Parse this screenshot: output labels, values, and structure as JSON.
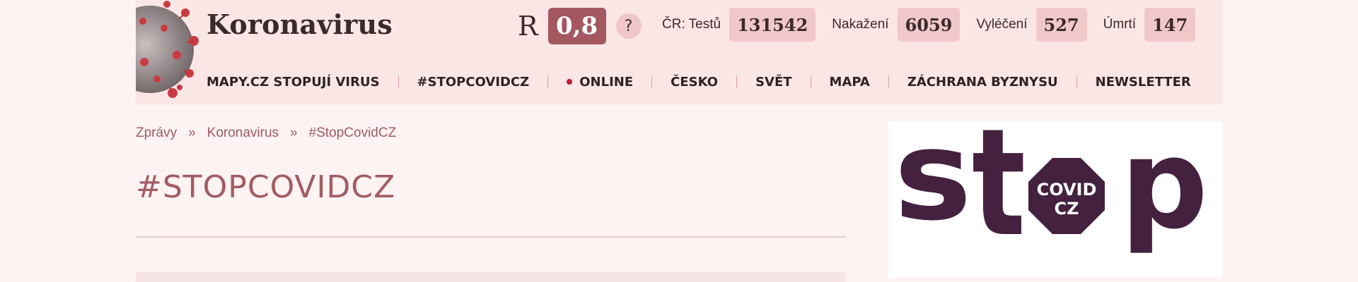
{
  "header": {
    "logo_text": "Koronavirus",
    "r_label": "R",
    "r_value": "0,8",
    "help_label": "?",
    "stats": [
      {
        "label": "ČR:  Testů",
        "value": "131542"
      },
      {
        "label": "Nakažení",
        "value": "6059"
      },
      {
        "label": "Vyléčení",
        "value": "527"
      },
      {
        "label": "Úmrtí",
        "value": "147"
      }
    ],
    "nav": [
      {
        "label": "MAPY.CZ STOPUJÍ VIRUS"
      },
      {
        "label": "#STOPCOVIDCZ"
      },
      {
        "label": "ONLINE",
        "live": true
      },
      {
        "label": "ČESKO"
      },
      {
        "label": "SVĚT"
      },
      {
        "label": "MAPA"
      },
      {
        "label": "ZÁCHRANA BYZNYSU"
      },
      {
        "label": "NEWSLETTER"
      }
    ]
  },
  "breadcrumb": {
    "items": [
      "Zprávy",
      "Koronavirus",
      "#StopCovidCZ"
    ],
    "separator": "»"
  },
  "page_title": "#STOPCOVIDCZ",
  "sidebar_logo": {
    "word": "stop",
    "badge_line1": "COVID",
    "badge_line2": "CZ"
  },
  "colors": {
    "header_bg": "#fae6e5",
    "page_bg": "#fdf3f2",
    "accent": "#a35b64",
    "r_badge": "#a3575f",
    "stat_badge": "#f1c8ca",
    "logo_purple": "#44213f",
    "live_dot": "#c0182c"
  }
}
